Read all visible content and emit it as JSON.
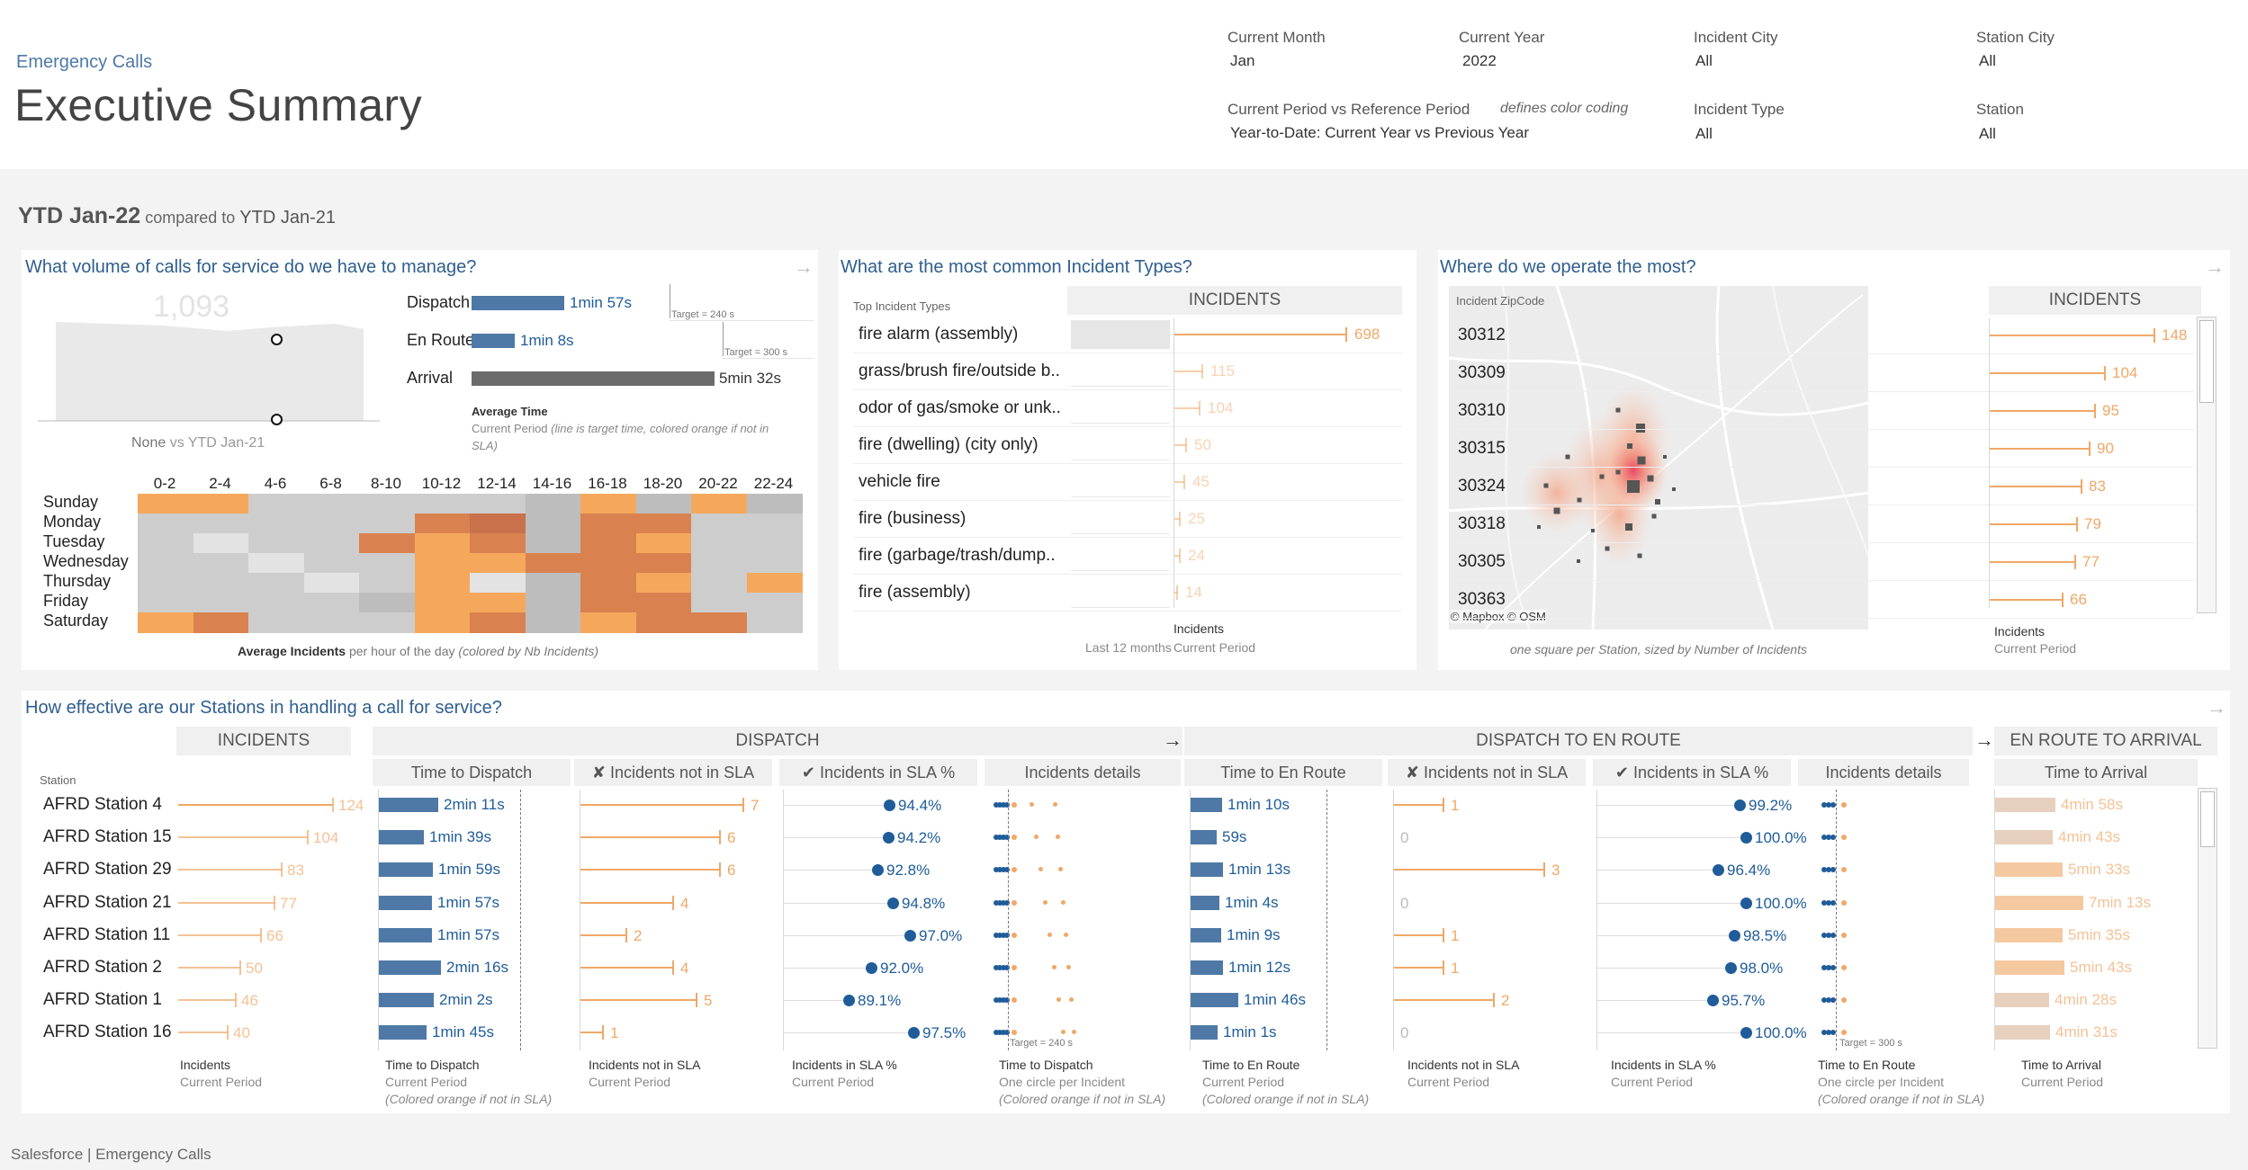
{
  "header": {
    "brand": "Emergency Calls",
    "title": "Executive Summary",
    "filters": [
      {
        "label": "Current Month",
        "value": "Jan"
      },
      {
        "label": "Current Year",
        "value": "2022"
      },
      {
        "label": "Incident City",
        "value": "All"
      },
      {
        "label": "Station City",
        "value": "All"
      },
      {
        "label": "Current Period vs Reference Period",
        "note": "defines color coding",
        "value": "Year-to-Date: Current Year vs Previous Year"
      },
      {
        "label": "Incident Type",
        "value": "All"
      },
      {
        "label": "Station",
        "value": "All"
      }
    ]
  },
  "period": {
    "current": "YTD Jan-22",
    "middle": "compared to",
    "reference": "YTD Jan-21"
  },
  "volume": {
    "title": "What volume of calls for service do we have to manage?",
    "big_number": "1,093",
    "compare_none": "None",
    "compare_ref": "vs YTD Jan-21",
    "times": [
      {
        "label": "Dispatch",
        "value": "1min 57s",
        "fraction": 0.49,
        "target": "Target = 240 s"
      },
      {
        "label": "En Route",
        "value": "1min 8s",
        "fraction": 0.23,
        "target": "Target = 300 s"
      },
      {
        "label": "Arrival",
        "value": "5min 32s",
        "fraction": 1.0
      }
    ],
    "avg_title": "Average Time",
    "avg_sub": "Current Period",
    "avg_note": "(line is target time, colored orange if not in SLA)",
    "heatmap": {
      "cols": [
        "0-2",
        "2-4",
        "4-6",
        "6-8",
        "8-10",
        "10-12",
        "12-14",
        "14-16",
        "16-18",
        "18-20",
        "20-22",
        "22-24"
      ],
      "rows": [
        "Sunday",
        "Monday",
        "Tuesday",
        "Wednesday",
        "Thursday",
        "Friday",
        "Saturday"
      ],
      "levels": [
        [
          3,
          3,
          1,
          1,
          1,
          1,
          1,
          2,
          3,
          2,
          3,
          2
        ],
        [
          1,
          1,
          1,
          1,
          1,
          4,
          5,
          2,
          4,
          4,
          1,
          1
        ],
        [
          1,
          0,
          1,
          1,
          4,
          3,
          4,
          2,
          4,
          3,
          1,
          1
        ],
        [
          1,
          1,
          0,
          1,
          1,
          3,
          3,
          4,
          4,
          4,
          1,
          1
        ],
        [
          1,
          1,
          1,
          0,
          1,
          3,
          0,
          2,
          4,
          3,
          1,
          3
        ],
        [
          1,
          1,
          1,
          1,
          2,
          3,
          3,
          2,
          4,
          4,
          1,
          1
        ],
        [
          3,
          4,
          1,
          1,
          1,
          3,
          4,
          2,
          3,
          4,
          4,
          1
        ]
      ],
      "caption_bold": "Average Incidents",
      "caption_rest": "per hour of the day",
      "caption_note": "(colored by Nb Incidents)"
    }
  },
  "types": {
    "title": "What are the most common Incident Types?",
    "subheader": "Top Incident Types",
    "col_header": "INCIDENTS",
    "items": [
      {
        "label": "fire alarm (assembly)",
        "value": 698
      },
      {
        "label": "grass/brush fire/outside b..",
        "value": 115
      },
      {
        "label": "odor of gas/smoke or unk..",
        "value": 104
      },
      {
        "label": "fire (dwelling) (city only)",
        "value": 50
      },
      {
        "label": "vehicle fire",
        "value": 45
      },
      {
        "label": "fire (business)",
        "value": 25
      },
      {
        "label": "fire (garbage/trash/dump..",
        "value": 24
      },
      {
        "label": "fire (assembly)",
        "value": 14
      }
    ],
    "footer_left": "Last 12 months",
    "footer_title": "Incidents",
    "footer_sub": "Current Period"
  },
  "map": {
    "title": "Where do we operate the most?",
    "attribution": "© Mapbox © OSM",
    "caption": "one square per Station, sized by Number of Incidents",
    "zip_header": "Incident ZipCode",
    "col_header": "INCIDENTS",
    "items": [
      {
        "zip": "30312",
        "value": 148
      },
      {
        "zip": "30309",
        "value": 104
      },
      {
        "zip": "30310",
        "value": 95
      },
      {
        "zip": "30315",
        "value": 90
      },
      {
        "zip": "30324",
        "value": 83
      },
      {
        "zip": "30318",
        "value": 79
      },
      {
        "zip": "30305",
        "value": 77
      },
      {
        "zip": "30363",
        "value": 66
      }
    ],
    "footer_title": "Incidents",
    "footer_sub": "Current Period"
  },
  "stations": {
    "title": "How effective are our Stations in handling a call for service?",
    "station_label": "Station",
    "group_headers": {
      "incidents": "INCIDENTS",
      "dispatch": "DISPATCH",
      "enroute": "DISPATCH TO EN ROUTE",
      "arrival": "EN ROUTE TO ARRIVAL"
    },
    "col_headers": [
      "Time to Dispatch",
      "✘ Incidents not in SLA",
      "✔ Incidents in SLA %",
      "Incidents details",
      "Time to En Route",
      "✘ Incidents not in SLA",
      "✔ Incidents in SLA %",
      "Incidents details",
      "Time to Arrival"
    ],
    "rows": [
      {
        "name": "AFRD Station 4",
        "incidents": 124,
        "t_disp": "2min 11s",
        "t_disp_f": 0.131,
        "nsla_d": 7,
        "sla_d": "94.4%",
        "sla_d_v": 94.4,
        "t_er": "1min 10s",
        "t_er_f": 0.07,
        "nsla_e": 1,
        "sla_e": "99.2%",
        "sla_e_v": 99.2,
        "t_arr": "4min 58s",
        "t_arr_f": 0.298
      },
      {
        "name": "AFRD Station 15",
        "incidents": 104,
        "t_disp": "1min 39s",
        "t_disp_f": 0.099,
        "nsla_d": 6,
        "sla_d": "94.2%",
        "sla_d_v": 94.2,
        "t_er": "59s",
        "t_er_f": 0.059,
        "nsla_e": 0,
        "sla_e": "100.0%",
        "sla_e_v": 100.0,
        "t_arr": "4min 43s",
        "t_arr_f": 0.283
      },
      {
        "name": "AFRD Station 29",
        "incidents": 83,
        "t_disp": "1min 59s",
        "t_disp_f": 0.119,
        "nsla_d": 6,
        "sla_d": "92.8%",
        "sla_d_v": 92.8,
        "t_er": "1min 13s",
        "t_er_f": 0.073,
        "nsla_e": 3,
        "sla_e": "96.4%",
        "sla_e_v": 96.4,
        "t_arr": "5min 33s",
        "t_arr_f": 0.333
      },
      {
        "name": "AFRD Station 21",
        "incidents": 77,
        "t_disp": "1min 57s",
        "t_disp_f": 0.117,
        "nsla_d": 4,
        "sla_d": "94.8%",
        "sla_d_v": 94.8,
        "t_er": "1min 4s",
        "t_er_f": 0.064,
        "nsla_e": 0,
        "sla_e": "100.0%",
        "sla_e_v": 100.0,
        "t_arr": "7min 13s",
        "t_arr_f": 0.433
      },
      {
        "name": "AFRD Station 11",
        "incidents": 66,
        "t_disp": "1min 57s",
        "t_disp_f": 0.117,
        "nsla_d": 2,
        "sla_d": "97.0%",
        "sla_d_v": 97.0,
        "t_er": "1min 9s",
        "t_er_f": 0.069,
        "nsla_e": 1,
        "sla_e": "98.5%",
        "sla_e_v": 98.5,
        "t_arr": "5min 35s",
        "t_arr_f": 0.335
      },
      {
        "name": "AFRD Station 2",
        "incidents": 50,
        "t_disp": "2min 16s",
        "t_disp_f": 0.136,
        "nsla_d": 4,
        "sla_d": "92.0%",
        "sla_d_v": 92.0,
        "t_er": "1min 12s",
        "t_er_f": 0.072,
        "nsla_e": 1,
        "sla_e": "98.0%",
        "sla_e_v": 98.0,
        "t_arr": "5min 43s",
        "t_arr_f": 0.343
      },
      {
        "name": "AFRD Station 1",
        "incidents": 46,
        "t_disp": "2min 2s",
        "t_disp_f": 0.122,
        "nsla_d": 5,
        "sla_d": "89.1%",
        "sla_d_v": 89.1,
        "t_er": "1min 46s",
        "t_er_f": 0.106,
        "nsla_e": 2,
        "sla_e": "95.7%",
        "sla_e_v": 95.7,
        "t_arr": "4min 28s",
        "t_arr_f": 0.268
      },
      {
        "name": "AFRD Station 16",
        "incidents": 40,
        "t_disp": "1min 45s",
        "t_disp_f": 0.105,
        "nsla_d": 1,
        "sla_d": "97.5%",
        "sla_d_v": 97.5,
        "t_er": "1min 1s",
        "t_er_f": 0.061,
        "nsla_e": 0,
        "sla_e": "100.0%",
        "sla_e_v": 100.0,
        "t_arr": "4min 31s",
        "t_arr_f": 0.271
      }
    ],
    "targets": {
      "dispatch": "Target = 240 s",
      "enroute": "Target = 300 s"
    },
    "footers": [
      {
        "title": "Incidents",
        "sub": "Current Period",
        "note": ""
      },
      {
        "title": "Time to Dispatch",
        "sub": "Current Period",
        "note": "(Colored orange if not in SLA)"
      },
      {
        "title": "Incidents not in SLA",
        "sub": "Current Period",
        "note": ""
      },
      {
        "title": "Incidents in SLA %",
        "sub": "Current Period",
        "note": ""
      },
      {
        "title": "Time to Dispatch",
        "sub": "One circle per Incident",
        "note": "(Colored orange if not in SLA)"
      },
      {
        "title": "Time to En Route",
        "sub": "Current Period",
        "note": "(Colored orange if not in SLA)"
      },
      {
        "title": "Incidents not in SLA",
        "sub": "Current Period",
        "note": ""
      },
      {
        "title": "Incidents in SLA %",
        "sub": "Current Period",
        "note": ""
      },
      {
        "title": "Time to En Route",
        "sub": "One circle per Incident",
        "note": "(Colored orange if not in SLA)"
      },
      {
        "title": "Time to Arrival",
        "sub": "Current Period",
        "note": ""
      }
    ]
  },
  "footer": {
    "text": "Salesforce | Emergency Calls"
  },
  "colors": {
    "accent": "#4e79a7",
    "bar_blue": "#4e79a7",
    "orange": "#f0a868",
    "dark_orange": "#d9714a",
    "dot_blue": "#1f5c99",
    "gray_bar": "#6b6b6b"
  }
}
